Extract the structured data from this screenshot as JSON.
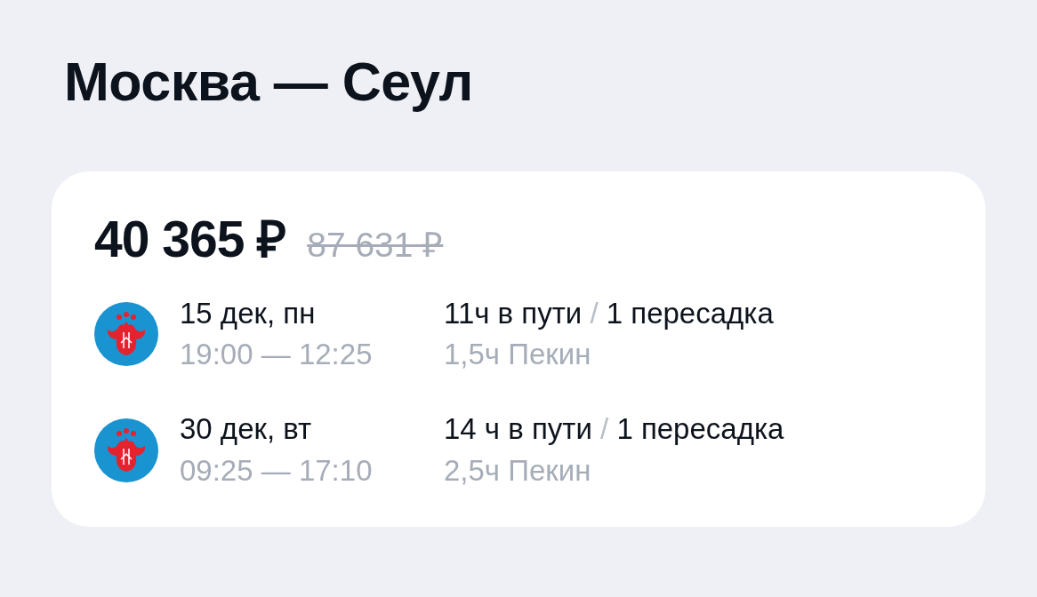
{
  "title": "Москва — Сеул",
  "offer": {
    "price": "40 365 ₽",
    "old_price": "87 631 ₽"
  },
  "flights": [
    {
      "date": "15 дек, пн",
      "times": "19:00 — 12:25",
      "duration": "11ч в пути",
      "separator": "/",
      "stops": "1 пересадка",
      "layover": "1,5ч Пекин"
    },
    {
      "date": "30 дек, вт",
      "times": "09:25 — 17:10",
      "duration": "14 ч в пути",
      "separator": "/",
      "stops": "1 пересадка",
      "layover": "2,5ч Пекин"
    }
  ]
}
